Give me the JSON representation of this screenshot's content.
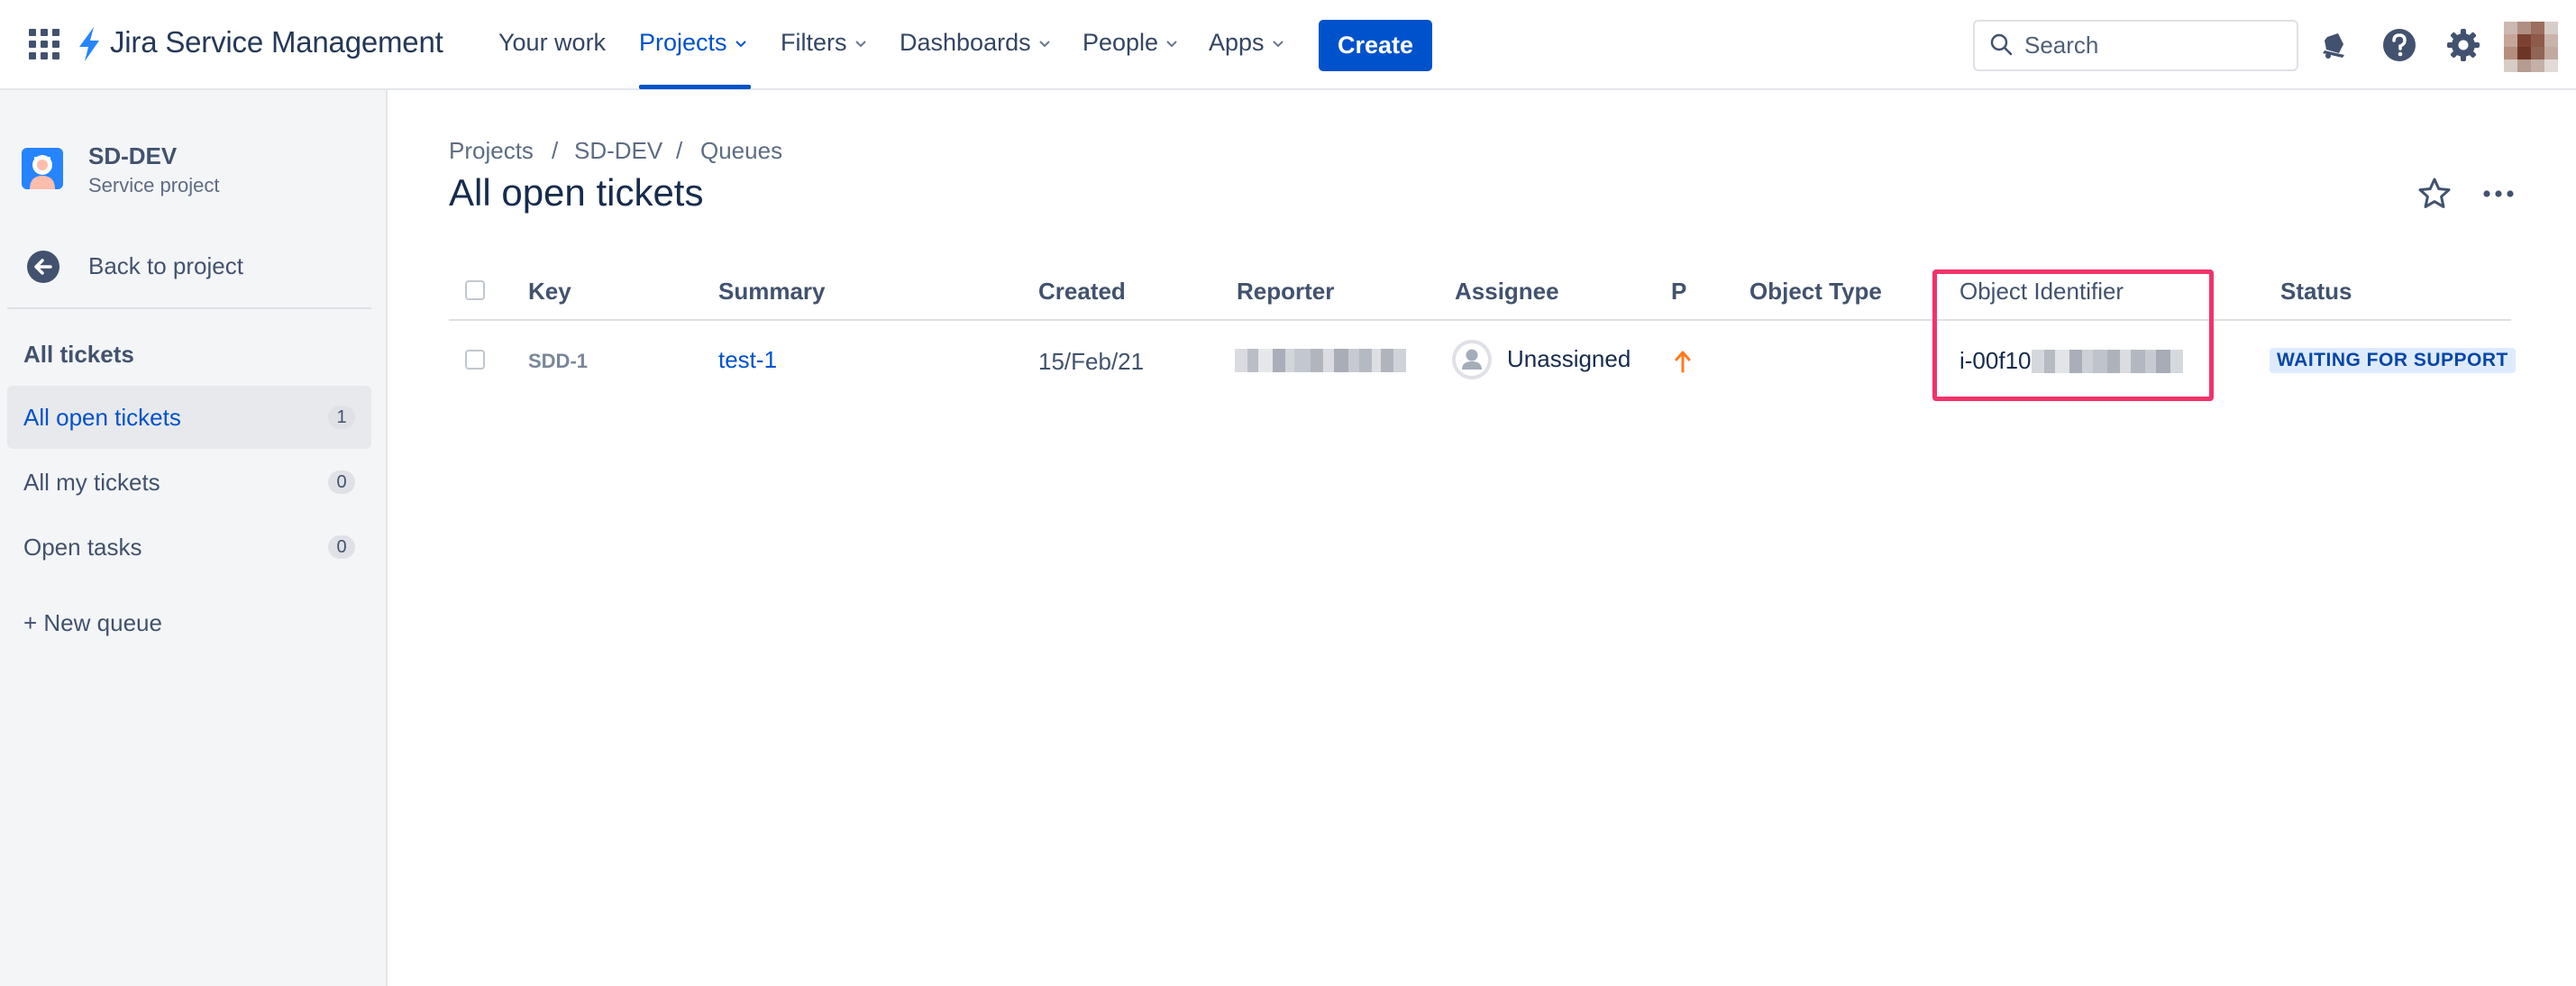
{
  "app": {
    "name": "Jira Service Management",
    "brand_color": "#0052cc"
  },
  "topnav": {
    "items": [
      {
        "label": "Your work",
        "has_dropdown": false,
        "active": false
      },
      {
        "label": "Projects",
        "has_dropdown": true,
        "active": true
      },
      {
        "label": "Filters",
        "has_dropdown": true,
        "active": false
      },
      {
        "label": "Dashboards",
        "has_dropdown": true,
        "active": false
      },
      {
        "label": "People",
        "has_dropdown": true,
        "active": false
      },
      {
        "label": "Apps",
        "has_dropdown": true,
        "active": false
      }
    ],
    "create_label": "Create",
    "search_placeholder": "Search",
    "icons": [
      "notifications-icon",
      "help-icon",
      "settings-icon",
      "profile-avatar"
    ]
  },
  "sidebar": {
    "project_name": "SD-DEV",
    "project_type": "Service project",
    "back_label": "Back to project",
    "section_title": "All tickets",
    "queues": [
      {
        "label": "All open tickets",
        "count": "1",
        "active": true
      },
      {
        "label": "All my tickets",
        "count": "0",
        "active": false
      },
      {
        "label": "Open tasks",
        "count": "0",
        "active": false
      }
    ],
    "new_queue_label": "+ New queue"
  },
  "main": {
    "breadcrumbs": [
      "Projects",
      "SD-DEV",
      "Queues"
    ],
    "breadcrumb_separator": "/",
    "title": "All open tickets",
    "columns": [
      "Key",
      "Summary",
      "Created",
      "Reporter",
      "Assignee",
      "P",
      "Object Type",
      "Object Identifier",
      "Status"
    ],
    "rows": [
      {
        "key": "SDD-1",
        "summary": "test-1",
        "created": "15/Feb/21",
        "reporter": "",
        "assignee": "Unassigned",
        "priority": "high-priority-icon",
        "object_type": "",
        "object_identifier": "i-00f10",
        "status": "WAITING FOR SUPPORT"
      }
    ],
    "highlight_color": "#f1336b",
    "status_color": "#0747a6"
  }
}
